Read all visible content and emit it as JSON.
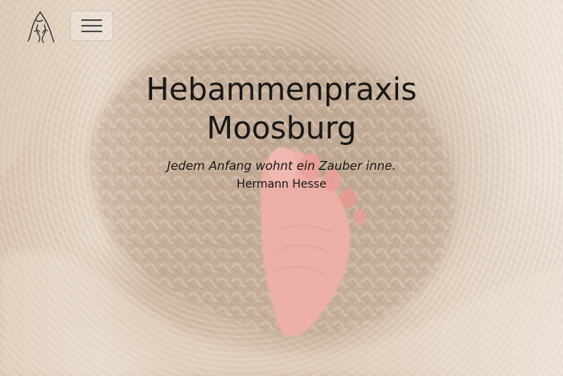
{
  "header": {
    "logo_icon": "stylized-woman-logo-icon",
    "menu_icon": "hamburger-menu-icon"
  },
  "hero": {
    "title": "Hebammenpraxis Moosburg",
    "quote": "Jedem Anfang wohnt ein Zauber inne.",
    "author": "Hermann Hesse",
    "background_image": "baby-foot-knitted-blanket-photo"
  },
  "colors": {
    "text": "#171717",
    "background_warm": "#d8c3ad",
    "background_light": "#efe5da",
    "accent_skin": "#e9a39b"
  }
}
